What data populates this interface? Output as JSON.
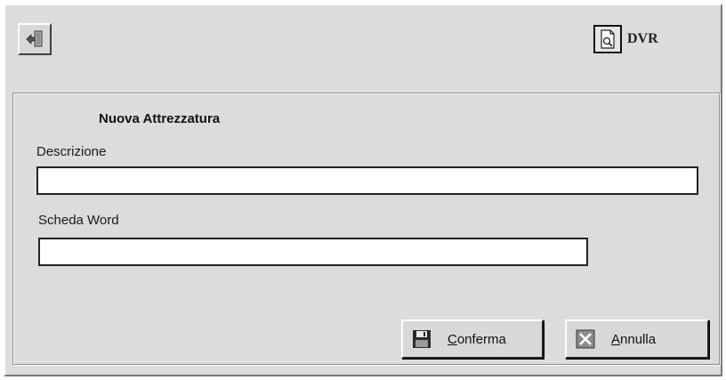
{
  "toolbar": {
    "exit_icon": "exit-door-icon",
    "dvr_icon": "document-preview-icon",
    "dvr_label": "DVR"
  },
  "form": {
    "title": "Nuova Attrezzatura",
    "descrizione_label": "Descrizione",
    "descrizione_value": "",
    "scheda_word_label": "Scheda Word",
    "scheda_word_value": ""
  },
  "buttons": {
    "conferma": {
      "mnemonic": "C",
      "rest": "onferma",
      "icon": "floppy-disk-icon"
    },
    "annulla": {
      "mnemonic": "A",
      "rest": "nnulla",
      "icon": "x-cancel-icon"
    }
  },
  "colors": {
    "window_bg": "#dcdcdc",
    "field_bg": "#ffffff"
  }
}
